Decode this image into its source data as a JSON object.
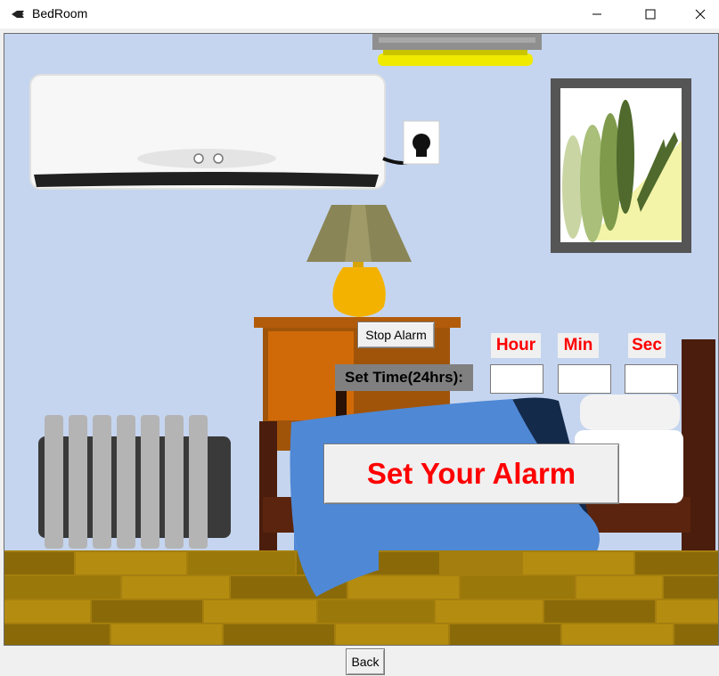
{
  "window": {
    "title": "BedRoom",
    "minimize": "—",
    "maximize": "☐",
    "close": "✕"
  },
  "controls": {
    "stop_alarm_label": "Stop Alarm",
    "set_time_label": "Set Time(24hrs):",
    "hour_label": "Hour",
    "min_label": "Min",
    "sec_label": "Sec",
    "hour_value": "",
    "min_value": "",
    "sec_value": "",
    "set_alarm_label": "Set Your Alarm",
    "back_label": "Back"
  },
  "colors": {
    "wall": "#c5d5ef",
    "floor": "#a47e0e",
    "accent_text": "#ff0000",
    "set_time_bg": "#808080",
    "blanket": "#4f88d5",
    "bed_frame": "#4a1d0c",
    "lamp_base": "#f4b200"
  }
}
